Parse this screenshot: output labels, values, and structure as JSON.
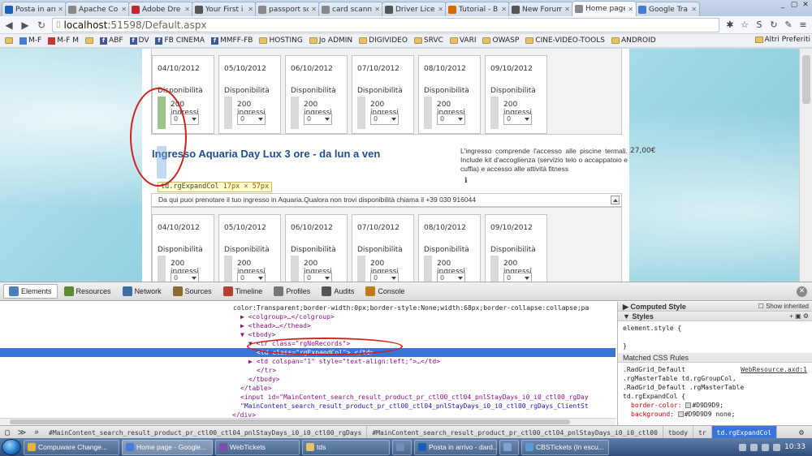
{
  "browser": {
    "tabs": [
      {
        "label": "Posta in arri",
        "color": "#1a5fb4",
        "active": false
      },
      {
        "label": "Apache Co",
        "color": "#888888",
        "active": false
      },
      {
        "label": "Adobe Dre",
        "color": "#c4262e",
        "active": false
      },
      {
        "label": "Your First i",
        "color": "#555555",
        "active": false
      },
      {
        "label": "passport sc",
        "color": "#888888",
        "active": false
      },
      {
        "label": "card scanni",
        "color": "#888888",
        "active": false
      },
      {
        "label": "Driver Licer",
        "color": "#555555",
        "active": false
      },
      {
        "label": "Tutorial - B",
        "color": "#d46a00",
        "active": false
      },
      {
        "label": "New Forum",
        "color": "#555555",
        "active": false
      },
      {
        "label": "Home page",
        "color": "#888888",
        "active": true
      },
      {
        "label": "Google Tra",
        "color": "#4b7bd8",
        "active": false
      }
    ],
    "url_host": "localhost",
    "url_path": ":51598/Default.aspx",
    "bookmarks": [
      {
        "label": "",
        "type": "folder"
      },
      {
        "label": "M-F",
        "type": "gg"
      },
      {
        "label": "M-F M",
        "type": "red"
      },
      {
        "label": "",
        "type": "folder"
      },
      {
        "label": "ABF",
        "type": "fb"
      },
      {
        "label": "DV",
        "type": "fb"
      },
      {
        "label": "FB CINEMA",
        "type": "fb"
      },
      {
        "label": "MMFF-FB",
        "type": "fb"
      },
      {
        "label": "HOSTING",
        "type": "folder"
      },
      {
        "label": "Jo ADMIN",
        "type": "folder"
      },
      {
        "label": "DIGIVIDEO",
        "type": "folder"
      },
      {
        "label": "SRVC",
        "type": "folder"
      },
      {
        "label": "VARI",
        "type": "folder"
      },
      {
        "label": "OWASP",
        "type": "folder"
      },
      {
        "label": "CINE-VIDEO-TOOLS",
        "type": "folder"
      },
      {
        "label": "ANDROID",
        "type": "folder"
      }
    ],
    "other_bookmarks": "Altri Preferiti"
  },
  "page": {
    "days_top": [
      {
        "date": "04/10/2012",
        "dispo": "Disponibilità",
        "ingressi": "200 ingressi",
        "qty": "0"
      },
      {
        "date": "05/10/2012",
        "dispo": "Disponibilità",
        "ingressi": "200 ingressi",
        "qty": "0"
      },
      {
        "date": "06/10/2012",
        "dispo": "Disponibilità",
        "ingressi": "200 ingressi",
        "qty": "0"
      },
      {
        "date": "07/10/2012",
        "dispo": "Disponibilità",
        "ingressi": "200 ingressi",
        "qty": "0"
      },
      {
        "date": "08/10/2012",
        "dispo": "Disponibilità",
        "ingressi": "200 ingressi",
        "qty": "0"
      },
      {
        "date": "09/10/2012",
        "dispo": "Disponibilità",
        "ingressi": "200 ingressi",
        "qty": "0"
      }
    ],
    "days_bottom": [
      {
        "date": "04/10/2012",
        "dispo": "Disponibilità",
        "ingressi": "200 ingressi",
        "qty": "0"
      },
      {
        "date": "05/10/2012",
        "dispo": "Disponibilità",
        "ingressi": "200 ingressi",
        "qty": "0"
      },
      {
        "date": "06/10/2012",
        "dispo": "Disponibilità",
        "ingressi": "200 ingressi",
        "qty": "0"
      },
      {
        "date": "07/10/2012",
        "dispo": "Disponibilità",
        "ingressi": "200 ingressi",
        "qty": "0"
      },
      {
        "date": "08/10/2012",
        "dispo": "Disponibilità",
        "ingressi": "200 ingressi",
        "qty": "0"
      },
      {
        "date": "09/10/2012",
        "dispo": "Disponibilità",
        "ingressi": "200 ingressi",
        "qty": "0"
      }
    ],
    "product_title": "Ingresso Aquaria Day Lux 3 ore - da lun a ven",
    "product_desc": "L'ingresso comprende l'accesso alle piscine termali. Include kit d'accoglienza (servizio telo o accappatoio e cuffia) e accesso alle attività fitness",
    "info_icon": "ℹ",
    "price": "27,00€",
    "notice": "Da qui puoi prenotare il tuo ingresso in Aquaria.Qualora non trovi disponibilità chiama il +39 030 916044",
    "tooltip_tag": "td.rgExpandCol",
    "tooltip_dims": "17px × 57px"
  },
  "devtools": {
    "tabs": [
      {
        "label": "Elements",
        "color": "#4a7fc1",
        "active": true
      },
      {
        "label": "Resources",
        "color": "#5c8a2e",
        "active": false
      },
      {
        "label": "Network",
        "color": "#3a6ea5",
        "active": false
      },
      {
        "label": "Sources",
        "color": "#8a6d2e",
        "active": false
      },
      {
        "label": "Timeline",
        "color": "#b3412e",
        "active": false
      },
      {
        "label": "Profiles",
        "color": "#777777",
        "active": false
      },
      {
        "label": "Audits",
        "color": "#555555",
        "active": false
      },
      {
        "label": "Console",
        "color": "#c07a1e",
        "active": false
      }
    ],
    "dom_lines": [
      {
        "indent": 0,
        "text": "color:Transparent;border-width:0px;border-style:None;width:68px;border-collapse:collapse;pa",
        "kind": "tx"
      },
      {
        "indent": 1,
        "text": "▶ <colgroup>…</colgroup>",
        "kind": "tg"
      },
      {
        "indent": 1,
        "text": "▶ <thead>…</thead>",
        "kind": "tg"
      },
      {
        "indent": 1,
        "text": "▼ <tbody>",
        "kind": "tg"
      },
      {
        "indent": 2,
        "text": "▼ <tr class=\"rgNoRecords\">",
        "kind": "tg"
      },
      {
        "indent": 3,
        "text": "<td class=\"rgExpandCol\"> </td>",
        "kind": "tg",
        "selected": true
      },
      {
        "indent": 2,
        "text": "▶ <td colspan=\"1\" style=\"text-align:left;\">…</td>",
        "kind": "tg"
      },
      {
        "indent": 3,
        "text": "</tr>",
        "kind": "tg"
      },
      {
        "indent": 2,
        "text": "</tbody>",
        "kind": "tg"
      },
      {
        "indent": 1,
        "text": "</table>",
        "kind": "tg"
      },
      {
        "indent": 1,
        "text": "<input id=\"MainContent_search_result_product_pr_ctl00_ctl04_pnlStayDays_i0_i0_ctl00_rgDay",
        "kind": "tg"
      },
      {
        "indent": 1,
        "text": "\"MainContent_search_result_product_pr_ctl00_ctl04_pnlStayDays_i0_i0_ctl00_rgDays_ClientSt",
        "kind": "av"
      },
      {
        "indent": 0,
        "text": "</div>",
        "kind": "tg"
      }
    ],
    "computed_style_label": "Computed Style",
    "show_inherited_label": "Show inherited",
    "styles_label": "Styles",
    "element_style": "element.style {",
    "element_style_close": "}",
    "matched_rules_label": "Matched CSS Rules",
    "selector_1": ".RadGrid_Default",
    "source_link": "WebResource.axd:1",
    "selector_2": ".rgMasterTable td.rgGroupCol,",
    "selector_3": ".RadGrid_Default .rgMasterTable",
    "selector_4": "td.rgExpandCol {",
    "prop_1_name": "border-color:",
    "prop_1_value": "#D9D9D9;",
    "prop_2_name": "background:",
    "prop_2_value": "#D9D9D9 none;",
    "breadcrumbs": [
      {
        "label": "#MainContent_search_result_product_pr_ctl00_ctl04_pnlStayDays_i0_i0_ctl00_rgDays",
        "active": false
      },
      {
        "label": "#MainContent_search_result_product_pr_ctl00_ctl04_pnlStayDays_i0_i0_ctl00",
        "active": false
      },
      {
        "label": "tbody",
        "active": false
      },
      {
        "label": "tr",
        "active": false
      },
      {
        "label": "td.rgExpandCol",
        "active": true
      }
    ]
  },
  "taskbar": {
    "items": [
      {
        "label": "Compuware Change...",
        "color": "#e7b23a",
        "width": 118,
        "active": false
      },
      {
        "label": "Home page - Google...",
        "color": "#4b7bd8",
        "width": 112,
        "active": true
      },
      {
        "label": "WebTickets",
        "color": "#7a4fb2",
        "width": 104,
        "active": false
      },
      {
        "label": "tds",
        "color": "#e8c267",
        "width": 108,
        "active": false
      },
      {
        "label": "",
        "color": "#6d8fb8",
        "width": 24,
        "active": false
      },
      {
        "label": "Posta in arrivo - dard...",
        "color": "#1a5fb4",
        "width": 102,
        "active": false
      },
      {
        "label": "",
        "color": "#7da4cc",
        "width": 24,
        "active": false
      },
      {
        "label": "CBSTickets (In escu...",
        "color": "#5b9bd5",
        "width": 108,
        "active": false
      }
    ],
    "clock": "10:33"
  }
}
